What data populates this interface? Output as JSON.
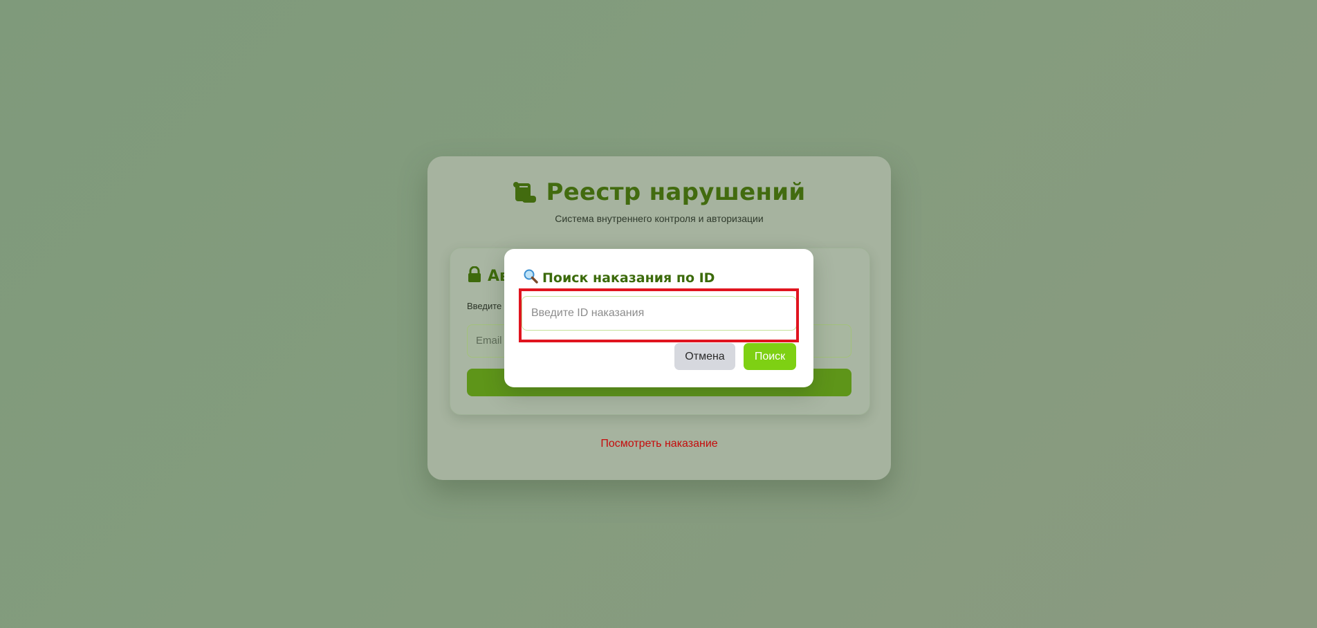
{
  "brand": {
    "title": "Реестр нарушений",
    "subtitle": "Система внутреннего контроля и авторизации",
    "icon": "scroll-icon"
  },
  "auth": {
    "heading_partial": "Ав",
    "hint_partial": "Введите",
    "email_placeholder_partial": "Email",
    "lock_icon": "lock-icon"
  },
  "footer": {
    "view_link": "Посмотреть наказание"
  },
  "modal": {
    "title": "Поиск наказания по ID",
    "title_icon": "magnifier-icon",
    "input_placeholder": "Введите ID наказания",
    "input_value": "",
    "cancel_label": "Отмена",
    "search_label": "Поиск"
  },
  "colors": {
    "accent": "#7ed013",
    "brand_green": "#426b0f",
    "highlight": "#e0141f",
    "link": "#c50b0b"
  }
}
